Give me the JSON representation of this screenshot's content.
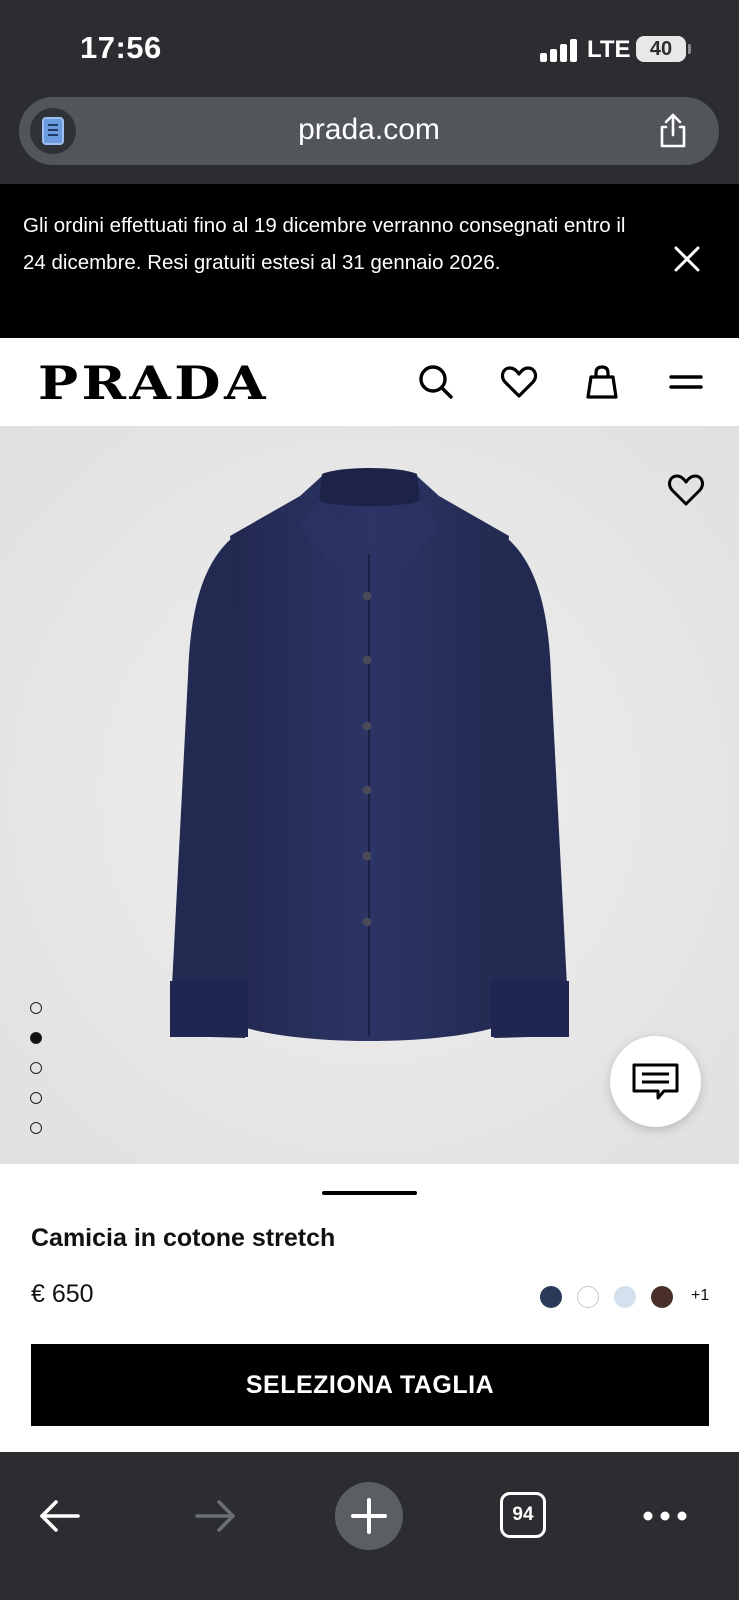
{
  "status_bar": {
    "time": "17:56",
    "network": "LTE",
    "battery": "40"
  },
  "browser": {
    "url": "prada.com",
    "tabs_count": "94",
    "icons": [
      "reader-icon",
      "share-icon",
      "back-icon",
      "forward-icon",
      "new-tab-icon",
      "tabs-icon",
      "more-icon"
    ]
  },
  "banner": {
    "text": "Gli ordini effettuati fino al 19 dicembre verranno consegnati entro il 24 dicembre. Resi gratuiti estesi al 31 gennaio 2026."
  },
  "header": {
    "logo": "PRADA",
    "icons": [
      "search-icon",
      "heart-icon",
      "bag-icon",
      "menu-icon"
    ]
  },
  "gallery": {
    "image_count": 5,
    "active_index": 2
  },
  "product": {
    "name": "Camicia in cotone stretch",
    "price": "€ 650",
    "swatches": [
      "#2a3a58",
      "#ffffff",
      "#d3e1ee",
      "#4a2f28"
    ],
    "more_colors": "+1",
    "cta_label": "SELEZIONA TAGLIA"
  }
}
